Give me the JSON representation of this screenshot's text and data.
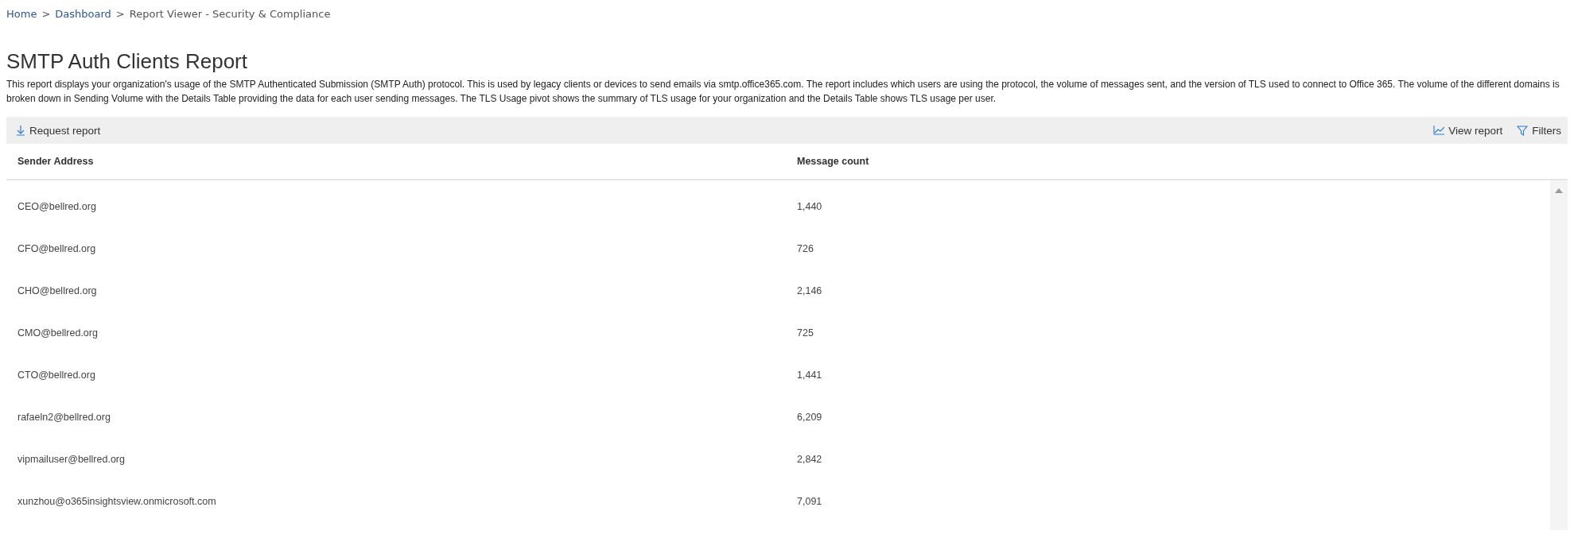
{
  "breadcrumb": {
    "separator": ">",
    "items": [
      {
        "label": "Home",
        "kind": "link"
      },
      {
        "label": "Dashboard",
        "kind": "link"
      },
      {
        "label": "Report Viewer - Security & Compliance",
        "kind": "text"
      }
    ]
  },
  "title": "SMTP Auth Clients Report",
  "description": "This report displays your organization's usage of the SMTP Authenticated Submission (SMTP Auth) protocol. This is used by legacy clients or devices to send emails via smtp.office365.com. The report includes which users are using the protocol, the volume of messages sent, and the version of TLS used to connect to Office 365. The volume of the different domains is broken down in Sending Volume with the Details Table providing the data for each user sending messages. The TLS Usage pivot shows the summary of TLS usage for your organization and the Details Table shows TLS usage per user.",
  "toolbar": {
    "left": [
      {
        "label": "Request report",
        "kind": "download"
      }
    ],
    "right": [
      {
        "label": "View report",
        "kind": "chart"
      },
      {
        "label": "Filters",
        "kind": "filter"
      }
    ]
  },
  "table": {
    "columns": [
      "Sender Address",
      "Message count"
    ],
    "rows": [
      [
        "CEO@bellred.org",
        "1,440"
      ],
      [
        "CFO@bellred.org",
        "726"
      ],
      [
        "CHO@bellred.org",
        "2,146"
      ],
      [
        "CMO@bellred.org",
        "725"
      ],
      [
        "CTO@bellred.org",
        "1,441"
      ],
      [
        "rafaeln2@bellred.org",
        "6,209"
      ],
      [
        "vipmailuser@bellred.org",
        "2,842"
      ],
      [
        "xunzhou@o365insightsview.onmicrosoft.com",
        "7,091"
      ]
    ]
  }
}
